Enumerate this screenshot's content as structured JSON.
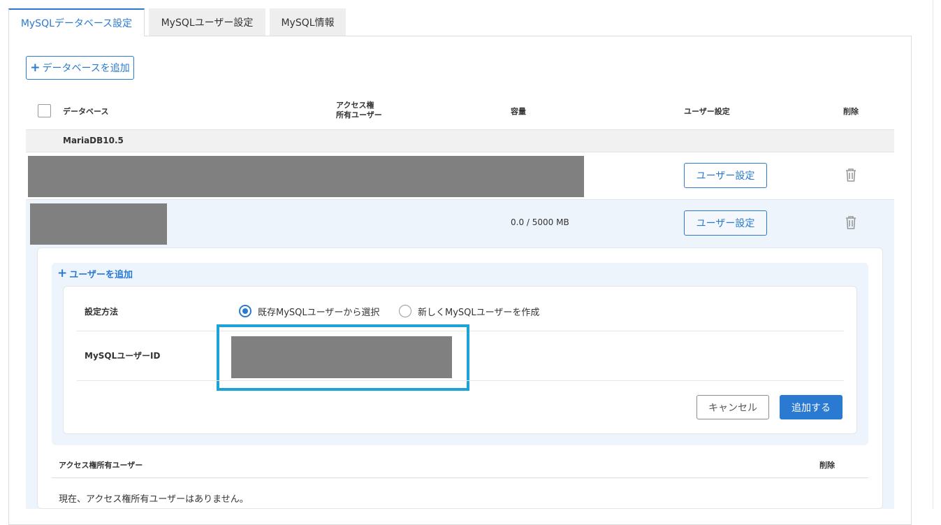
{
  "tabs": [
    {
      "label": "MySQLデータベース設定",
      "active": true
    },
    {
      "label": "MySQLユーザー設定",
      "active": false
    },
    {
      "label": "MySQL情報",
      "active": false
    }
  ],
  "add_db_button": {
    "label": "データベースを追加"
  },
  "table": {
    "headers": {
      "database": "データベース",
      "access_line1": "アクセス権",
      "access_line2": "所有ユーザー",
      "capacity": "容量",
      "user_settings": "ユーザー設定",
      "delete": "削除"
    },
    "group_label": "MariaDB10.5",
    "rows": [
      {
        "capacity": "",
        "user_settings_label": "ユーザー設定"
      },
      {
        "capacity": "0.0 / 5000 MB",
        "user_settings_label": "ユーザー設定"
      }
    ]
  },
  "add_user": {
    "link_label": "ユーザーを追加",
    "method_label": "設定方法",
    "option_existing": "既存MySQLユーザーから選択",
    "option_new": "新しくMySQLユーザーを作成",
    "selected": "existing",
    "user_id_label": "MySQLユーザーID",
    "cancel_label": "キャンセル",
    "submit_label": "追加する"
  },
  "access_users": {
    "header": "アクセス権所有ユーザー",
    "delete_header": "削除",
    "empty_message": "現在、アクセス権所有ユーザーはありません。"
  },
  "colors": {
    "accent": "#2a7ad2",
    "highlight": "#1ea3d9",
    "redacted": "#808080"
  }
}
